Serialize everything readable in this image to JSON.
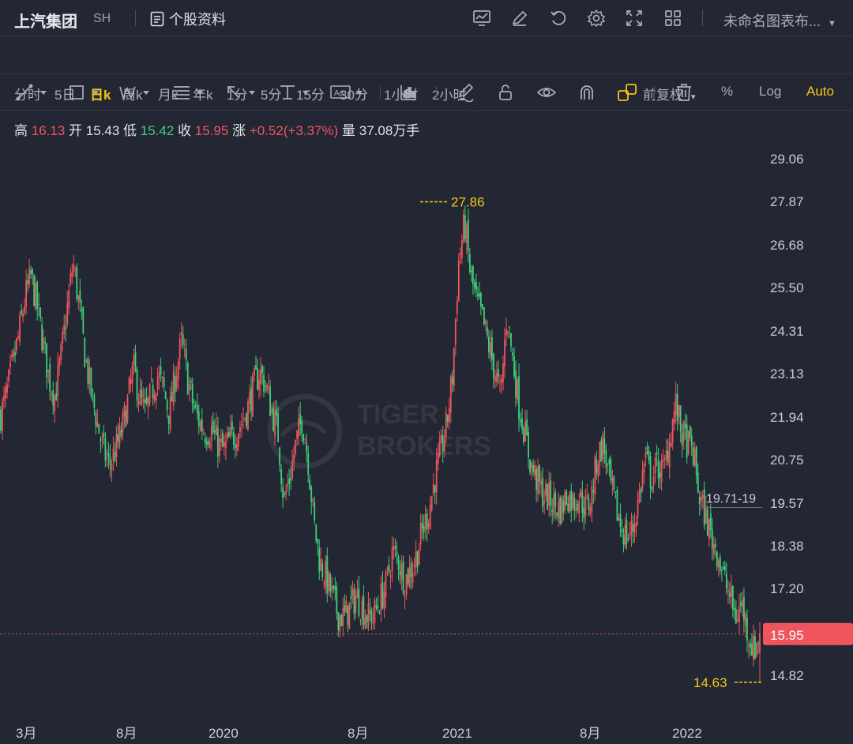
{
  "header": {
    "stock_name": "上汽集团",
    "exchange": "SH",
    "stock_info_label": "个股资料",
    "layout_name": "未命名图表布...",
    "icons": [
      "chart-icon",
      "edit-icon",
      "undo-icon",
      "settings-icon",
      "fullscreen-icon",
      "grid-icon"
    ]
  },
  "periods": [
    "分时",
    "5日",
    "日k",
    "周k",
    "月k",
    "年k",
    "1分",
    "5分",
    "15分",
    "30分",
    "1小时",
    "2小时"
  ],
  "active_period": "日k",
  "right_controls": {
    "adjust": "前复权",
    "percent": "%",
    "log": "Log",
    "auto": "Auto"
  },
  "ohlc": {
    "high_label": "高",
    "high": "16.13",
    "open_label": "开",
    "open": "15.43",
    "low_label": "低",
    "low": "15.42",
    "close_label": "收",
    "close": "15.95",
    "change_label": "涨",
    "change": "+0.52(+3.37%)",
    "volume_label": "量",
    "volume": "37.08万手"
  },
  "drawing_tools": [
    "trend-line-icon",
    "rectangle-icon",
    "pattern-icon",
    "fib-icon",
    "arrow-icon",
    "measure-icon",
    "text-icon",
    "indicator-icon",
    "pencil-icon",
    "lock-icon",
    "eye-icon",
    "magnet-icon",
    "link-icon",
    "trash-icon"
  ],
  "watermark": {
    "line1": "TIGER",
    "line2": "BROKERS"
  },
  "colors": {
    "up": "#f0545c",
    "down": "#3fcf7a",
    "accent": "#f5c518",
    "bg": "#232733"
  },
  "chart_data": {
    "type": "candlestick",
    "y_ticks": [
      "29.06",
      "27.87",
      "26.68",
      "25.50",
      "24.31",
      "23.13",
      "21.94",
      "20.75",
      "19.57",
      "18.38",
      "17.20",
      "14.82"
    ],
    "ylim": [
      14.0,
      29.6
    ],
    "x_ticks": [
      "3月",
      "8月",
      "2020",
      "8月",
      "2021",
      "8月",
      "2022"
    ],
    "current_price": 15.95,
    "current_price_label": "15.95",
    "max_marker": {
      "value": 27.86,
      "label": "27.86"
    },
    "min_marker": {
      "value": 14.63,
      "label": "14.63"
    },
    "level_label": "19.71-19",
    "level_value": 19.71,
    "close_series": [
      22.0,
      22.6,
      23.4,
      24.2,
      25.2,
      25.8,
      25.0,
      24.0,
      23.0,
      22.5,
      23.6,
      24.9,
      26.2,
      25.0,
      23.6,
      22.6,
      21.8,
      21.0,
      20.6,
      21.0,
      21.5,
      22.3,
      23.3,
      22.5,
      22.0,
      22.6,
      23.1,
      22.7,
      22.0,
      23.1,
      24.0,
      23.0,
      22.2,
      21.8,
      21.5,
      21.6,
      21.2,
      21.0,
      21.3,
      21.5,
      21.8,
      22.2,
      22.8,
      23.2,
      22.8,
      22.1,
      21.5,
      19.6,
      20.3,
      21.2,
      21.9,
      20.8,
      19.0,
      17.9,
      17.5,
      17.0,
      16.5,
      16.4,
      16.7,
      17.0,
      16.7,
      16.4,
      16.5,
      16.9,
      17.3,
      18.2,
      18.0,
      17.4,
      17.7,
      18.1,
      18.8,
      19.3,
      20.2,
      20.9,
      21.7,
      23.1,
      26.2,
      27.3,
      25.8,
      25.1,
      24.6,
      23.9,
      23.2,
      22.5,
      24.8,
      23.5,
      22.3,
      21.5,
      20.6,
      20.2,
      19.8,
      19.7,
      19.5,
      19.4,
      19.8,
      19.6,
      19.8,
      19.4,
      19.7,
      20.8,
      21.2,
      20.2,
      19.5,
      18.9,
      18.6,
      18.9,
      19.8,
      20.8,
      20.2,
      20.6,
      20.4,
      21.3,
      22.3,
      21.5,
      21.2,
      20.9,
      19.7,
      19.2,
      18.6,
      18.2,
      17.5,
      17.0,
      16.4,
      16.8,
      16.0,
      15.5,
      15.95
    ]
  }
}
